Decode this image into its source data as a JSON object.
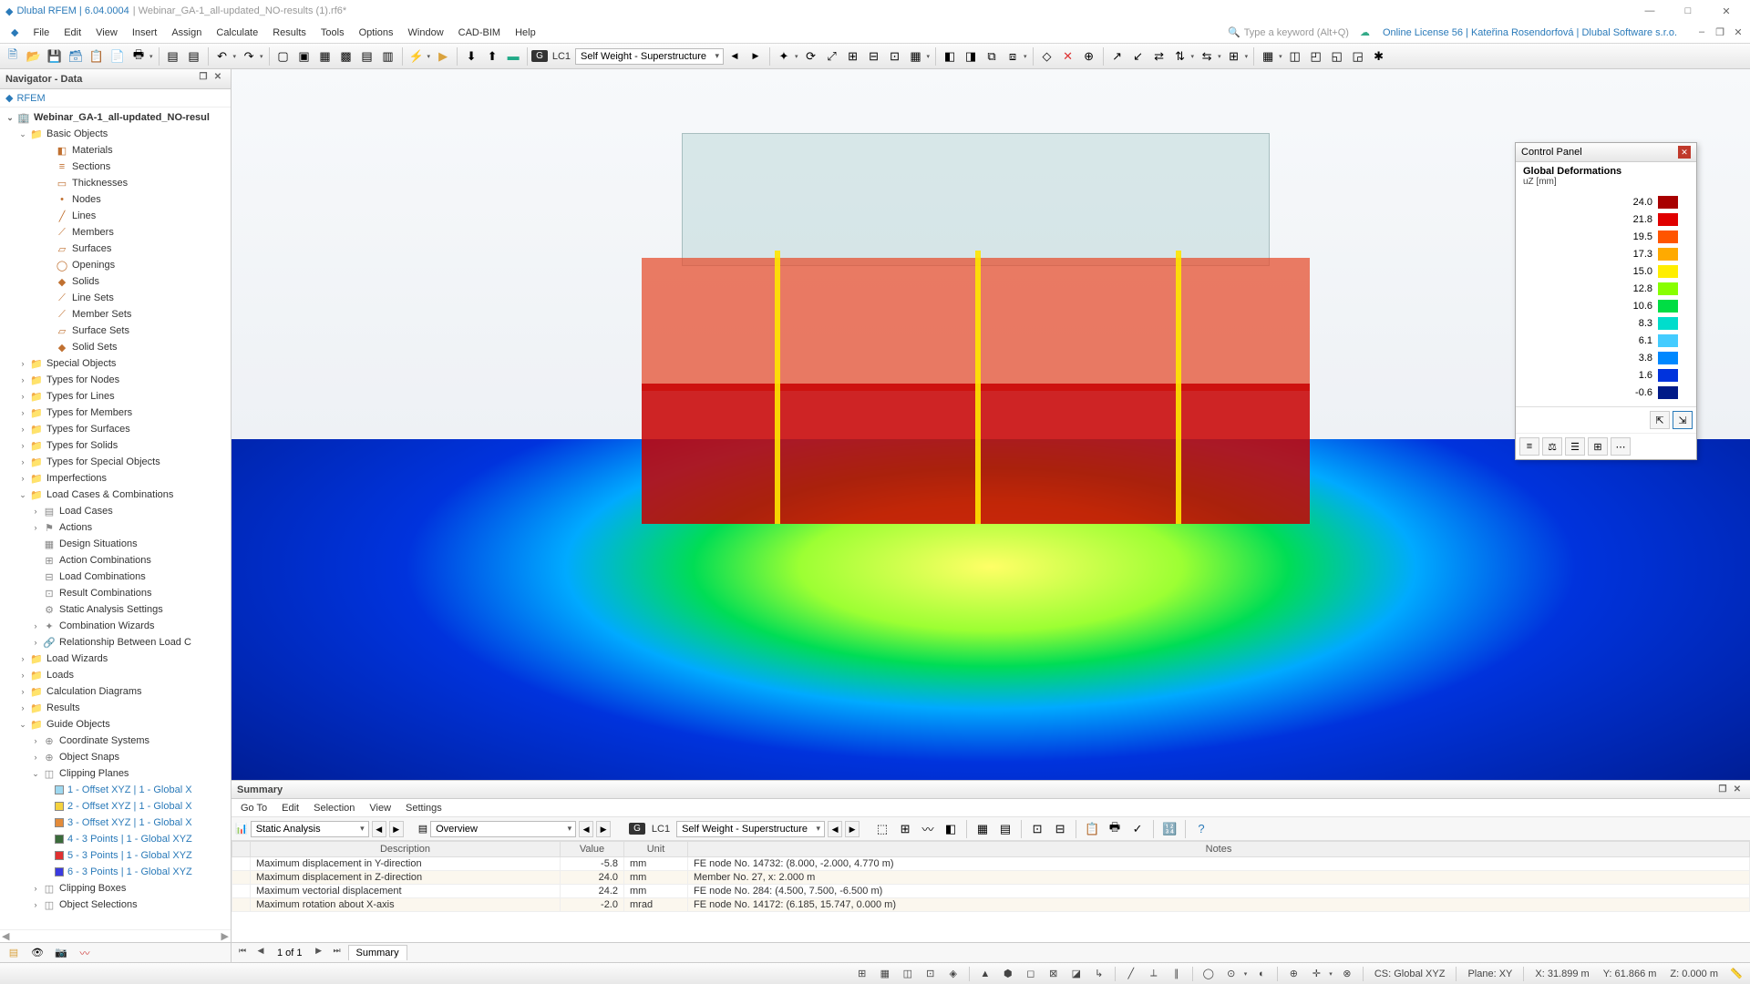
{
  "title": {
    "app": "Dlubal RFEM | 6.04.0004",
    "file": "| Webinar_GA-1_all-updated_NO-results (1).rf6*"
  },
  "window_controls": {
    "min": "—",
    "max": "□",
    "close": "✕"
  },
  "menu": [
    "File",
    "Edit",
    "View",
    "Insert",
    "Assign",
    "Calculate",
    "Results",
    "Tools",
    "Options",
    "Window",
    "CAD-BIM",
    "Help"
  ],
  "keyword_search": {
    "placeholder": "Type a keyword (Alt+Q)"
  },
  "license": "Online License 56 | Kateřina Rosendorfová | Dlubal Software s.r.o.",
  "toolbar": {
    "lc_badge": "G",
    "lc_code": "LC1",
    "lc_name": "Self Weight - Superstructure"
  },
  "navigator": {
    "title": "Navigator - Data",
    "root": "RFEM",
    "model": "Webinar_GA-1_all-updated_NO-resul",
    "basic_objects": "Basic Objects",
    "basic_children": [
      "Materials",
      "Sections",
      "Thicknesses",
      "Nodes",
      "Lines",
      "Members",
      "Surfaces",
      "Openings",
      "Solids",
      "Line Sets",
      "Member Sets",
      "Surface Sets",
      "Solid Sets"
    ],
    "folders": [
      "Special Objects",
      "Types for Nodes",
      "Types for Lines",
      "Types for Members",
      "Types for Surfaces",
      "Types for Solids",
      "Types for Special Objects",
      "Imperfections"
    ],
    "lcc": "Load Cases & Combinations",
    "lcc_children": [
      "Load Cases",
      "Actions",
      "Design Situations",
      "Action Combinations",
      "Load Combinations",
      "Result Combinations",
      "Static Analysis Settings",
      "Combination Wizards",
      "Relationship Between Load C"
    ],
    "folders2": [
      "Load Wizards",
      "Loads",
      "Calculation Diagrams",
      "Results"
    ],
    "guide": "Guide Objects",
    "guide_children": [
      "Coordinate Systems",
      "Object Snaps"
    ],
    "clipping": "Clipping Planes",
    "clips": [
      {
        "label": "1 - Offset XYZ | 1 - Global X",
        "color": "#9ed8f0"
      },
      {
        "label": "2 - Offset XYZ | 1 - Global X",
        "color": "#f5d23e"
      },
      {
        "label": "3 - Offset XYZ | 1 - Global X",
        "color": "#e38b3a"
      },
      {
        "label": "4 - 3 Points | 1 - Global XYZ",
        "color": "#3a6b3a"
      },
      {
        "label": "5 - 3 Points | 1 - Global XYZ",
        "color": "#e03030"
      },
      {
        "label": "6 - 3 Points | 1 - Global XYZ",
        "color": "#3a3ae0"
      }
    ],
    "after_clips": [
      "Clipping Boxes",
      "Object Selections"
    ]
  },
  "control_panel": {
    "title": "Control Panel",
    "subtitle": "Global Deformations",
    "unit": "uZ [mm]",
    "scale": [
      {
        "v": "24.0",
        "c": "#a80000"
      },
      {
        "v": "21.8",
        "c": "#e00000"
      },
      {
        "v": "19.5",
        "c": "#ff5500"
      },
      {
        "v": "17.3",
        "c": "#ffaa00"
      },
      {
        "v": "15.0",
        "c": "#ffee00"
      },
      {
        "v": "12.8",
        "c": "#88ff00"
      },
      {
        "v": "10.6",
        "c": "#00dd44"
      },
      {
        "v": "8.3",
        "c": "#00ddcc"
      },
      {
        "v": "6.1",
        "c": "#44ccff"
      },
      {
        "v": "3.8",
        "c": "#0088ff"
      },
      {
        "v": "1.6",
        "c": "#0033dd"
      },
      {
        "v": "-0.6",
        "c": "#001a88"
      }
    ]
  },
  "summary": {
    "title": "Summary",
    "menu": [
      "Go To",
      "Edit",
      "Selection",
      "View",
      "Settings"
    ],
    "combo1": "Static Analysis",
    "combo2": "Overview",
    "lc_badge": "G",
    "lc_code": "LC1",
    "lc_name": "Self Weight - Superstructure",
    "headers": [
      "Description",
      "Value",
      "Unit",
      "Notes"
    ],
    "rows": [
      {
        "d": "Maximum displacement in Y-direction",
        "v": "-5.8",
        "u": "mm",
        "n": "FE node No. 14732: (8.000, -2.000, 4.770 m)"
      },
      {
        "d": "Maximum displacement in Z-direction",
        "v": "24.0",
        "u": "mm",
        "n": "Member No. 27, x: 2.000 m"
      },
      {
        "d": "Maximum vectorial displacement",
        "v": "24.2",
        "u": "mm",
        "n": "FE node No. 284: (4.500, 7.500, -6.500 m)"
      },
      {
        "d": "Maximum rotation about X-axis",
        "v": "-2.0",
        "u": "mrad",
        "n": "FE node No. 14172: (6.185, 15.747, 0.000 m)"
      }
    ],
    "pager": "1 of 1",
    "tab": "Summary"
  },
  "status": {
    "cs": "CS: Global XYZ",
    "plane": "Plane: XY",
    "x": "X: 31.899 m",
    "y": "Y: 61.866 m",
    "z": "Z: 0.000 m"
  }
}
